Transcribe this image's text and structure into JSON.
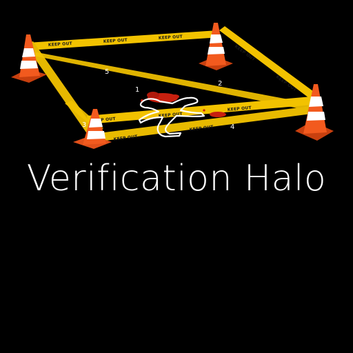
{
  "title": "Verification Halo",
  "tape_text": "KEEP OUT",
  "markers": [
    "1",
    "2",
    "3",
    "4",
    "5"
  ],
  "icons": [
    "traffic-cone-icon",
    "caution-tape-icon",
    "body-outline-icon",
    "blood-splatter-icon"
  ],
  "colors": {
    "background": "#000000",
    "tape": "#f2c200",
    "tape_text": "#1a1a1a",
    "cone": "#f25a1e",
    "cone_stripe": "#ffffff",
    "blood": "#c8200f",
    "title": "#ffffff"
  }
}
